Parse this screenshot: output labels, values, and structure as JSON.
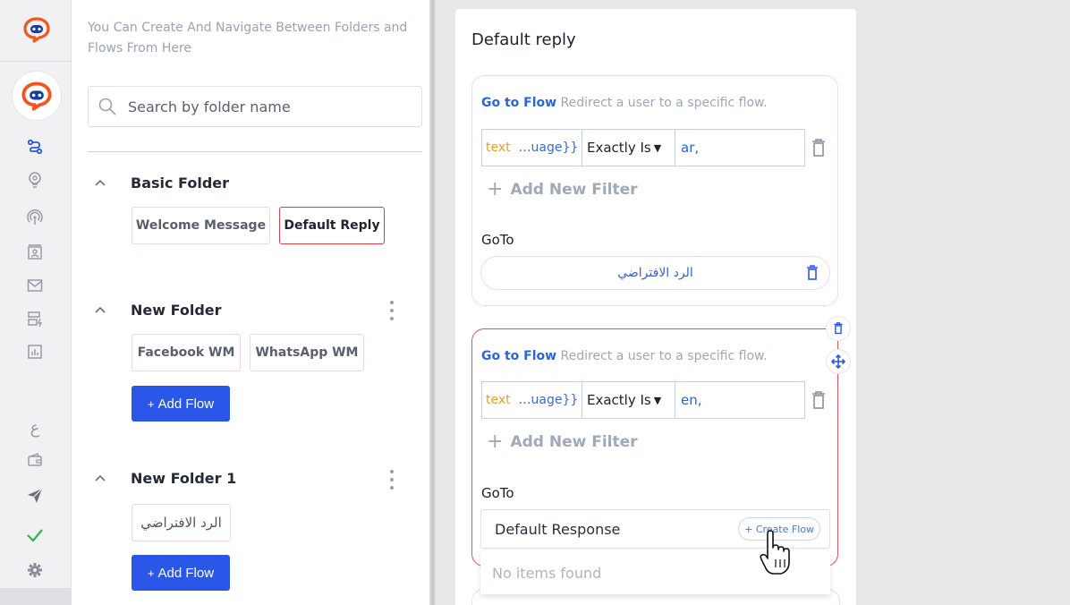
{
  "rail": {
    "icons": [
      "flows-icon",
      "bulb-icon",
      "broadcast-icon",
      "contacts-icon",
      "mail-icon",
      "template-icon",
      "analytics-icon",
      "language-icon",
      "wallet-icon",
      "send-icon",
      "check-icon",
      "settings-icon"
    ],
    "language_glyph": "ع"
  },
  "folders": {
    "hint": "You Can Create And Navigate Between Folders and Flows From Here",
    "search_placeholder": "Search by folder name",
    "add_flow_label": "Add Flow",
    "add_flow_plus": "+",
    "list": [
      {
        "name": "Basic Folder",
        "flows": [
          "Welcome Message",
          "Default Reply"
        ],
        "active_flow": "Default Reply"
      },
      {
        "name": "New Folder",
        "flows": [
          "Facebook WM",
          "WhatsApp WM"
        ]
      },
      {
        "name": "New Folder 1",
        "flows": [
          "الرد الافتراضي"
        ]
      }
    ]
  },
  "panel": {
    "title": "Default reply",
    "cards": [
      {
        "go_to_flow": "Go to Flow",
        "go_to_flow_desc": "Redirect a user to a specific flow.",
        "filter": {
          "field_a": "text",
          "field_b": "…uage}}",
          "operator": "Exactly Is",
          "value": "ar,"
        },
        "add_filter": "Add New Filter",
        "goto_label": "GoTo",
        "goto_value": "الرد الافتراضي"
      },
      {
        "go_to_flow": "Go to Flow",
        "go_to_flow_desc": "Redirect a user to a specific flow.",
        "filter": {
          "field_a": "text",
          "field_b": "…uage}}",
          "operator": "Exactly Is",
          "value": "en,"
        },
        "add_filter": "Add New Filter",
        "goto_label": "GoTo",
        "goto_value": "Default Response",
        "create_flow": "+ Create Flow",
        "dropdown_empty": "No items found"
      }
    ]
  },
  "colors": {
    "accent_blue": "#2a57e8",
    "link_blue": "#2a66d6",
    "active_red": "#de3c4b",
    "brand_orange": "#f0561e"
  }
}
